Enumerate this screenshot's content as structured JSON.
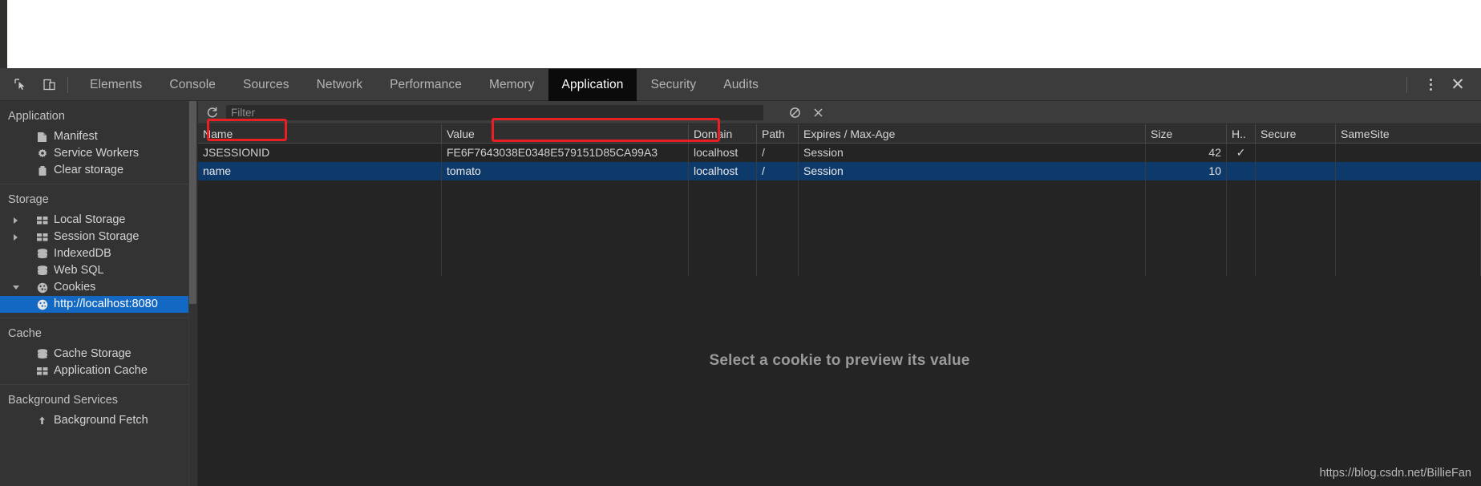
{
  "toolbar": {
    "inspect_icon": "inspect-element-icon",
    "device_icon": "toggle-device-toolbar-icon",
    "more_icon": "more-options-icon",
    "close_icon": "close-devtools-icon",
    "tabs": [
      {
        "label": "Elements",
        "active": false
      },
      {
        "label": "Console",
        "active": false
      },
      {
        "label": "Sources",
        "active": false
      },
      {
        "label": "Network",
        "active": false
      },
      {
        "label": "Performance",
        "active": false
      },
      {
        "label": "Memory",
        "active": false
      },
      {
        "label": "Application",
        "active": true
      },
      {
        "label": "Security",
        "active": false
      },
      {
        "label": "Audits",
        "active": false
      }
    ]
  },
  "sidebar": {
    "groups": [
      {
        "title": "Application",
        "items": [
          {
            "label": "Manifest",
            "icon": "document-icon",
            "indent": "sub",
            "arrow": "none",
            "selected": false
          },
          {
            "label": "Service Workers",
            "icon": "gear-icon",
            "indent": "sub",
            "arrow": "none",
            "selected": false
          },
          {
            "label": "Clear storage",
            "icon": "trash-icon",
            "indent": "sub",
            "arrow": "none",
            "selected": false
          }
        ]
      },
      {
        "title": "Storage",
        "items": [
          {
            "label": "Local Storage",
            "icon": "table-icon",
            "indent": "sub",
            "arrow": "closed",
            "selected": false
          },
          {
            "label": "Session Storage",
            "icon": "table-icon",
            "indent": "sub",
            "arrow": "closed",
            "selected": false
          },
          {
            "label": "IndexedDB",
            "icon": "database-icon",
            "indent": "sub",
            "arrow": "none",
            "selected": false
          },
          {
            "label": "Web SQL",
            "icon": "database-icon",
            "indent": "sub",
            "arrow": "none",
            "selected": false
          },
          {
            "label": "Cookies",
            "icon": "cookie-icon",
            "indent": "sub",
            "arrow": "open",
            "selected": false
          },
          {
            "label": "http://localhost:8080",
            "icon": "cookie-icon",
            "indent": "sub2",
            "arrow": "none",
            "selected": true
          }
        ]
      },
      {
        "title": "Cache",
        "items": [
          {
            "label": "Cache Storage",
            "icon": "database-icon",
            "indent": "sub",
            "arrow": "none",
            "selected": false
          },
          {
            "label": "Application Cache",
            "icon": "table-icon",
            "indent": "sub",
            "arrow": "none",
            "selected": false
          }
        ]
      },
      {
        "title": "Background Services",
        "items": [
          {
            "label": "Background Fetch",
            "icon": "upload-icon",
            "indent": "sub",
            "arrow": "none",
            "selected": false
          }
        ]
      }
    ]
  },
  "filterbar": {
    "refresh_icon": "refresh-icon",
    "placeholder": "Filter",
    "value": "",
    "clear_icon": "clear-all-icon",
    "close_icon": "delete-selected-icon"
  },
  "cookies_table": {
    "columns": [
      "Name",
      "Value",
      "Domain",
      "Path",
      "Expires / Max-Age",
      "Size",
      "H..",
      "Secure",
      "SameSite"
    ],
    "rows": [
      {
        "name": "JSESSIONID",
        "value": "FE6F7643038E0348E579151D85CA99A3",
        "domain": "localhost",
        "path": "/",
        "expires": "Session",
        "size": "42",
        "httponly": "✓",
        "secure": "",
        "samesite": "",
        "selected": false
      },
      {
        "name": "name",
        "value": "tomato",
        "domain": "localhost",
        "path": "/",
        "expires": "Session",
        "size": "10",
        "httponly": "",
        "secure": "",
        "samesite": "",
        "selected": true
      }
    ]
  },
  "preview": {
    "message": "Select a cookie to preview its value"
  },
  "annotations": {
    "highlight_color": "#e81f23",
    "name_box": "JSESSIONID",
    "value_box": "FE6F7643038E0348E579151D85CA99A3"
  },
  "watermark": {
    "text": "https://blog.csdn.net/BillieFan"
  }
}
